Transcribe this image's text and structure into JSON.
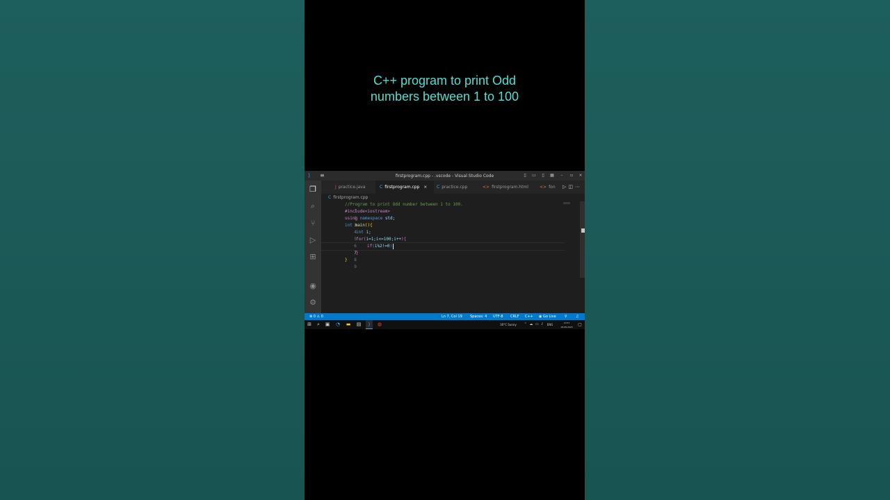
{
  "caption": {
    "line1": "C++ program to print Odd",
    "line2": "numbers between 1 to 100"
  },
  "window": {
    "title": "firstprogram.cpp - .vscode - Visual Studio Code",
    "logo_icon": "vscode-icon",
    "menu_icon": "hamburger-icon",
    "controls": [
      "–",
      "▫",
      "×"
    ]
  },
  "activity_bar": {
    "items": [
      "explorer-icon",
      "search-icon",
      "source-control-icon",
      "run-debug-icon",
      "extensions-icon"
    ],
    "bottom": [
      "account-icon",
      "gear-icon"
    ]
  },
  "tabs": [
    {
      "label": "practice.java",
      "icon": "J",
      "icon_color": "#e34c4c",
      "active": false
    },
    {
      "label": "firstprogram.cpp",
      "icon": "C",
      "icon_color": "#4aa3df",
      "active": true,
      "close": "×"
    },
    {
      "label": "practice.cpp",
      "icon": "C",
      "icon_color": "#4aa3df",
      "active": false
    },
    {
      "label": "firstprogram.html",
      "icon": "<>",
      "icon_color": "#e37933",
      "active": false
    },
    {
      "label": "fon",
      "icon": "<>",
      "icon_color": "#e37933",
      "active": false
    }
  ],
  "breadcrumb": {
    "file": "firstprogram.cpp",
    "icon": "C"
  },
  "editor": {
    "line_numbers": [
      "1",
      "2",
      "3",
      "4",
      "5",
      "6",
      "7",
      "8",
      "9"
    ],
    "current_line": "7",
    "l1": "//Program to print Odd number between 1 to 100.",
    "l2": "#include<iostream>",
    "l3_kw1": "using",
    "l3_kw2": "namespace",
    "l3_rest": " std;",
    "l4_kw": "int",
    "l4_fn": " main",
    "l4_p": "()",
    "l4_b": "{",
    "l5_kw": "int",
    "l5_rest": " i;",
    "l6_kw": "for",
    "l6_open": "(",
    "l6_mid": "i=1;i<=100;i++",
    "l6_close": ")",
    "l6_b": "{",
    "l7_kw": "if",
    "l7_open": "(",
    "l7_mid": "i%2!=0",
    "l7_close": ")",
    "l8_b": "}",
    "l9_b": "}"
  },
  "statusbar": {
    "problems": "⊗ 0 ⚠ 0",
    "position": "Ln 7, Col 19",
    "spaces": "Spaces: 4",
    "encoding": "UTF-8",
    "eol": "CRLF",
    "language": "C++",
    "golive": "Go Live"
  },
  "taskbar": {
    "weather": "30°C  Sunny",
    "lang": "ENG",
    "time": "10:57",
    "date": "18-08-2023"
  }
}
